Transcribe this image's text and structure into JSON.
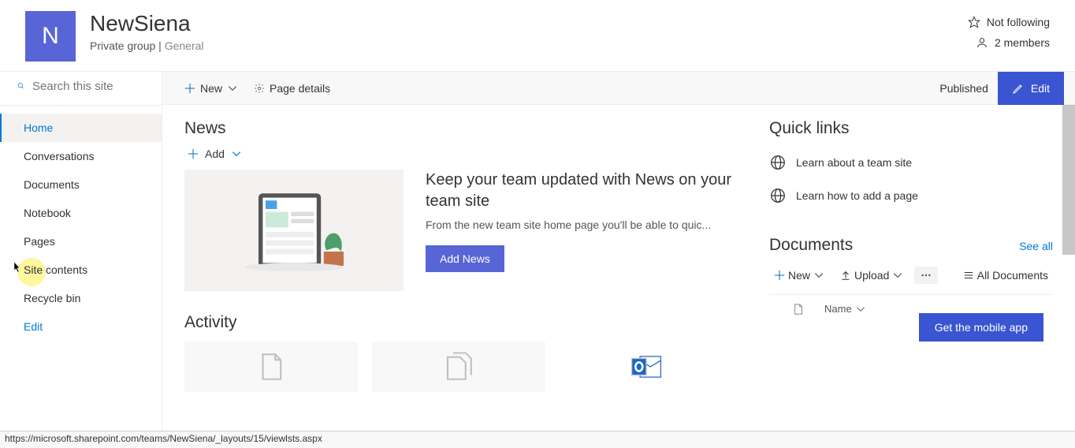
{
  "site": {
    "logo_letter": "N",
    "title": "NewSiena",
    "group_type": "Private group",
    "channel": "General"
  },
  "header_right": {
    "follow": "Not following",
    "members": "2 members"
  },
  "search": {
    "placeholder": "Search this site"
  },
  "nav": {
    "home": "Home",
    "conversations": "Conversations",
    "documents": "Documents",
    "notebook": "Notebook",
    "pages": "Pages",
    "site_contents": "Site contents",
    "recycle": "Recycle bin",
    "edit": "Edit"
  },
  "toolbar": {
    "new": "New",
    "page_details": "Page details",
    "published": "Published",
    "edit": "Edit"
  },
  "news": {
    "title": "News",
    "add": "Add",
    "heading": "Keep your team updated with News on your team site",
    "desc": "From the new team site home page you'll be able to quic...",
    "button": "Add News"
  },
  "quick_links": {
    "title": "Quick links",
    "link1": "Learn about a team site",
    "link2": "Learn how to add a page"
  },
  "documents": {
    "title": "Documents",
    "see_all": "See all",
    "new": "New",
    "upload": "Upload",
    "all": "All Documents",
    "col_name": "Name"
  },
  "activity": {
    "title": "Activity"
  },
  "mobile_app": "Get the mobile app",
  "status_url": "https://microsoft.sharepoint.com/teams/NewSiena/_layouts/15/viewlsts.aspx"
}
